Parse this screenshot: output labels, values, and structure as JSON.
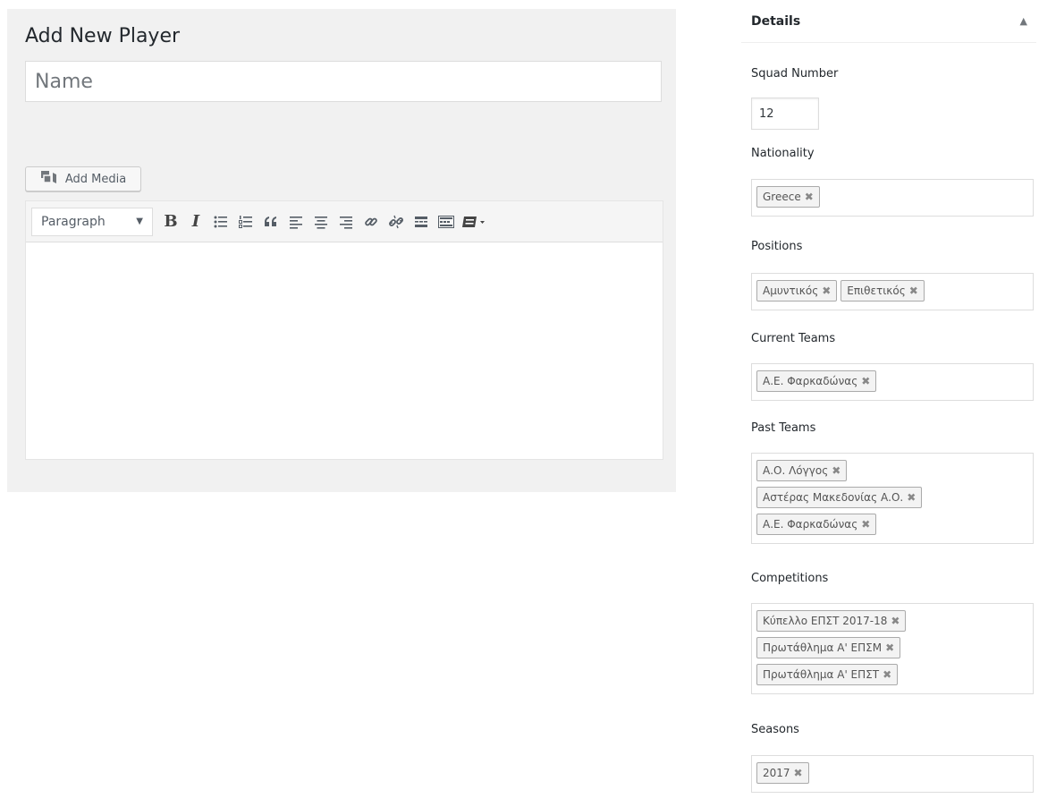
{
  "editor": {
    "page_title": "Add New Player",
    "title_placeholder": "Name",
    "title_value": "",
    "add_media_label": "Add Media",
    "format_select_value": "Paragraph",
    "toolbar": {
      "bold_label": "B",
      "italic_label": "I",
      "buttons": [
        "bold-icon",
        "italic-icon",
        "bullet-list-icon",
        "numbered-list-icon",
        "blockquote-icon",
        "align-left-icon",
        "align-center-icon",
        "align-right-icon",
        "link-icon",
        "unlink-icon",
        "read-more-icon",
        "toolbar-toggle-icon",
        "shortcode-icon"
      ]
    },
    "content": ""
  },
  "details": {
    "title": "Details",
    "toggle_glyph": "▲",
    "squad_number_label": "Squad Number",
    "squad_number_value": "12",
    "nationality_label": "Nationality",
    "nationality_tags": [
      "Greece"
    ],
    "positions_label": "Positions",
    "positions_tags": [
      "Αμυντικός",
      "Επιθετικός"
    ],
    "current_teams_label": "Current Teams",
    "current_teams_tags": [
      "Α.Ε. Φαρκαδώνας"
    ],
    "past_teams_label": "Past Teams",
    "past_teams_tags": [
      "Α.Ο. Λόγγος",
      "Αστέρας Μακεδονίας Α.Ο.",
      "Α.Ε. Φαρκαδώνας"
    ],
    "competitions_label": "Competitions",
    "competitions_tags": [
      "Κύπελλο ΕΠΣΤ 2017-18",
      "Πρωτάθλημα Α' ΕΠΣΜ",
      "Πρωτάθλημα Α' ΕΠΣΤ"
    ],
    "seasons_label": "Seasons",
    "seasons_tags": [
      "2017"
    ],
    "remove_glyph": "✖"
  },
  "colors": {
    "panel_bg": "#f1f1f1",
    "border": "#dddddd",
    "text": "#23282d",
    "icon": "#555d66"
  }
}
